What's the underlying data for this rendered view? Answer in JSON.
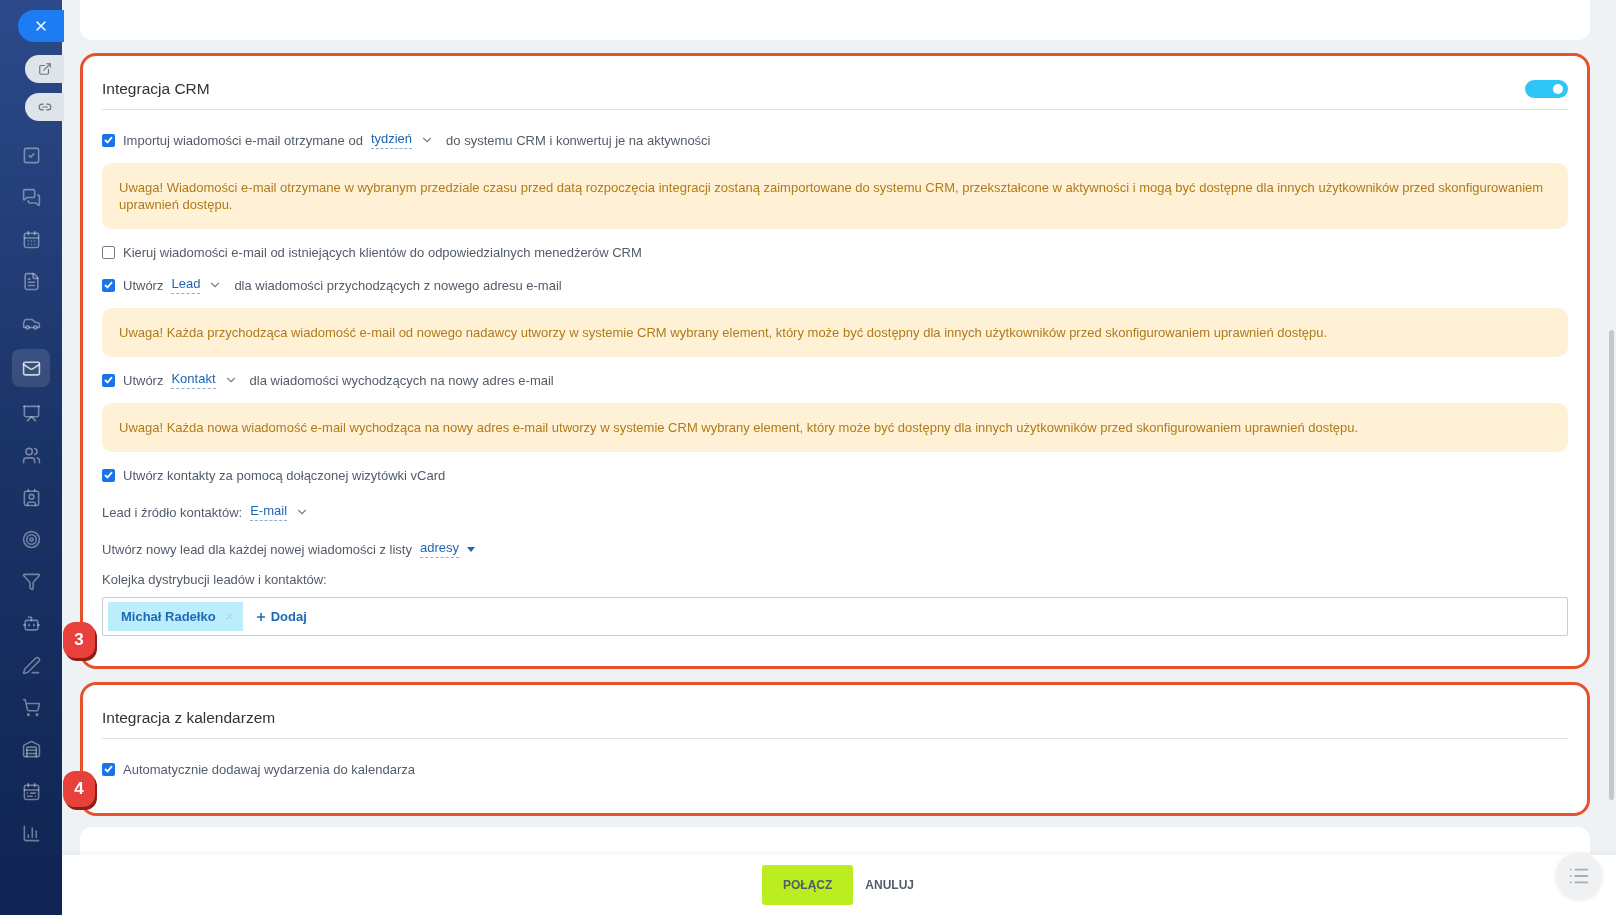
{
  "sidebar": {
    "items": [
      {
        "selected": false
      },
      {
        "selected": false
      },
      {
        "selected": false
      },
      {
        "selected": false
      },
      {
        "selected": false
      },
      {
        "selected": true
      },
      {
        "selected": false
      },
      {
        "selected": false
      },
      {
        "selected": false
      },
      {
        "selected": false
      },
      {
        "selected": false
      },
      {
        "selected": false
      },
      {
        "selected": false
      },
      {
        "selected": false
      },
      {
        "selected": false
      },
      {
        "selected": false
      },
      {
        "selected": false
      }
    ]
  },
  "crm": {
    "title": "Integracja CRM",
    "enabled": true,
    "badge": "3",
    "items": [
      {
        "kind": "checkbox",
        "checked": true,
        "before": "Importuj wiadomości e-mail otrzymane od",
        "select": {
          "value": "tydzień",
          "kind": "chevron"
        },
        "after": "do systemu CRM i konwertuj je na aktywności"
      },
      {
        "kind": "warning",
        "text": "Uwaga! Wiadomości e-mail otrzymane w wybranym przedziale czasu przed datą rozpoczęcia integracji zostaną zaimportowane do systemu CRM, przekształcone w aktywności i mogą być dostępne dla innych użytkowników przed skonfigurowaniem uprawnień dostępu."
      },
      {
        "kind": "checkbox",
        "checked": false,
        "before": "Kieruj wiadomości e-mail od istniejących klientów do odpowiedzialnych menedżerów CRM"
      },
      {
        "kind": "checkbox",
        "checked": true,
        "before": "Utwórz",
        "select": {
          "value": "Lead",
          "kind": "chevron"
        },
        "after": "dla wiadomości przychodzących z nowego adresu e-mail"
      },
      {
        "kind": "warning",
        "text": "Uwaga! Każda przychodząca wiadomość e-mail od nowego nadawcy utworzy w systemie CRM wybrany element, który może być dostępny dla innych użytkowników przed skonfigurowaniem uprawnień dostępu."
      },
      {
        "kind": "checkbox",
        "checked": true,
        "before": "Utwórz",
        "select": {
          "value": "Kontakt",
          "kind": "chevron"
        },
        "after": "dla wiadomości wychodzących na nowy adres e-mail"
      },
      {
        "kind": "warning",
        "text": "Uwaga! Każda nowa wiadomość e-mail wychodząca na nowy adres e-mail utworzy w systemie CRM wybrany element, który może być dostępny dla innych użytkowników przed skonfigurowaniem uprawnień dostępu."
      },
      {
        "kind": "checkbox",
        "checked": true,
        "before": "Utwórz kontakty za pomocą dołączonej wizytówki vCard"
      },
      {
        "kind": "field",
        "before": "Lead i źródło kontaktów:",
        "select": {
          "value": "E-mail",
          "kind": "chevron"
        }
      },
      {
        "kind": "field",
        "before": "Utwórz nowy lead dla każdej nowej wiadomości z listy",
        "select": {
          "value": "adresy",
          "kind": "triangle"
        }
      },
      {
        "kind": "queue",
        "label": "Kolejka dystrybucji leadów i kontaktów:",
        "tags": [
          "Michał Radełko"
        ],
        "add": "Dodaj"
      }
    ]
  },
  "calendar": {
    "title": "Integracja z kalendarzem",
    "badge": "4",
    "items": [
      {
        "kind": "checkbox",
        "checked": true,
        "before": "Automatycznie dodawaj wydarzenia do kalendarza"
      }
    ]
  },
  "footer": {
    "buttons": [
      {
        "label": "POŁĄCZ",
        "kind": "primary"
      },
      {
        "label": "ANULUJ",
        "kind": "link"
      }
    ]
  }
}
